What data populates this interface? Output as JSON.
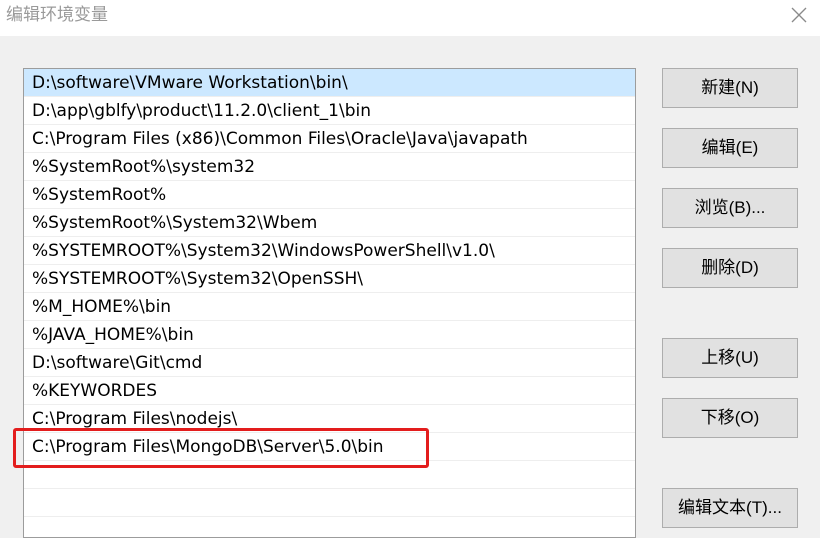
{
  "window": {
    "title": "编辑环境变量"
  },
  "path_list": {
    "items": [
      "D:\\software\\VMware Workstation\\bin\\",
      "D:\\app\\gblfy\\product\\11.2.0\\client_1\\bin",
      "C:\\Program Files (x86)\\Common Files\\Oracle\\Java\\javapath",
      "%SystemRoot%\\system32",
      "%SystemRoot%",
      "%SystemRoot%\\System32\\Wbem",
      "%SYSTEMROOT%\\System32\\WindowsPowerShell\\v1.0\\",
      "%SYSTEMROOT%\\System32\\OpenSSH\\",
      "%M_HOME%\\bin",
      "%JAVA_HOME%\\bin",
      "D:\\software\\Git\\cmd",
      "%KEYWORDES",
      "C:\\Program Files\\nodejs\\",
      "C:\\Program Files\\MongoDB\\Server\\5.0\\bin"
    ],
    "selected_index": 0,
    "highlighted_item": "C:\\Program Files\\MongoDB\\Server\\5.0\\bin"
  },
  "buttons": {
    "new": "新建(N)",
    "edit": "编辑(E)",
    "browse": "浏览(B)...",
    "delete": "删除(D)",
    "move_up": "上移(U)",
    "move_down": "下移(O)",
    "edit_text": "编辑文本(T)..."
  },
  "colors": {
    "selection": "#cce8ff",
    "highlight_box": "#e31d1d",
    "button_face": "#e1e1e1"
  },
  "icons": {
    "close": "close-icon"
  }
}
